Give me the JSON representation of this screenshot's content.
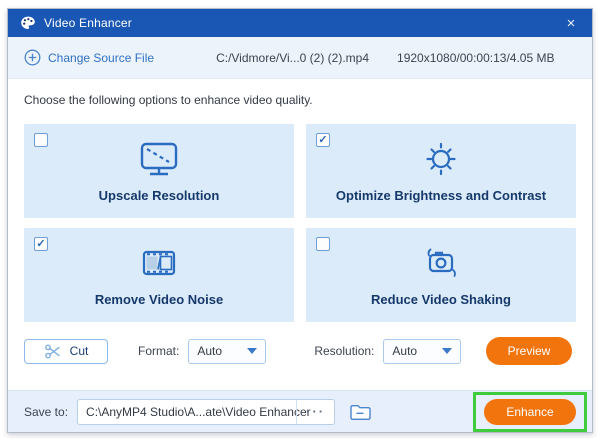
{
  "window": {
    "title": "Video Enhancer"
  },
  "icons": {
    "close": "×",
    "check": "✓",
    "ellipsis": "···"
  },
  "source": {
    "change_button": "Change Source File",
    "file_path": "C:/Vidmore/Vi...0 (2) (2).mp4",
    "file_info": "1920x1080/00:00:13/4.05 MB"
  },
  "instruction": "Choose the following options to enhance video quality.",
  "options": [
    {
      "label": "Upscale Resolution",
      "checked": false,
      "icon": "monitor-upscale-icon"
    },
    {
      "label": "Optimize Brightness and Contrast",
      "checked": true,
      "icon": "brightness-sun-icon"
    },
    {
      "label": "Remove Video Noise",
      "checked": true,
      "icon": "filmstrip-icon"
    },
    {
      "label": "Reduce Video Shaking",
      "checked": false,
      "icon": "camera-shake-icon"
    }
  ],
  "controls": {
    "cut_label": "Cut",
    "format_label": "Format:",
    "format_value": "Auto",
    "resolution_label": "Resolution:",
    "resolution_value": "Auto",
    "preview_label": "Preview"
  },
  "footer": {
    "save_to_label": "Save to:",
    "save_path": "C:\\AnyMP4 Studio\\A...ate\\Video Enhancer",
    "enhance_label": "Enhance"
  },
  "colors": {
    "title_bar_blue": "#1a57b5",
    "header_bg": "#edf3fa",
    "card_bg": "#dcebfa",
    "icon_blue": "#2a6cc0",
    "accent_orange": "#f2740c",
    "highlight_green": "#3ecb3e",
    "footer_bg": "#e6effb"
  }
}
